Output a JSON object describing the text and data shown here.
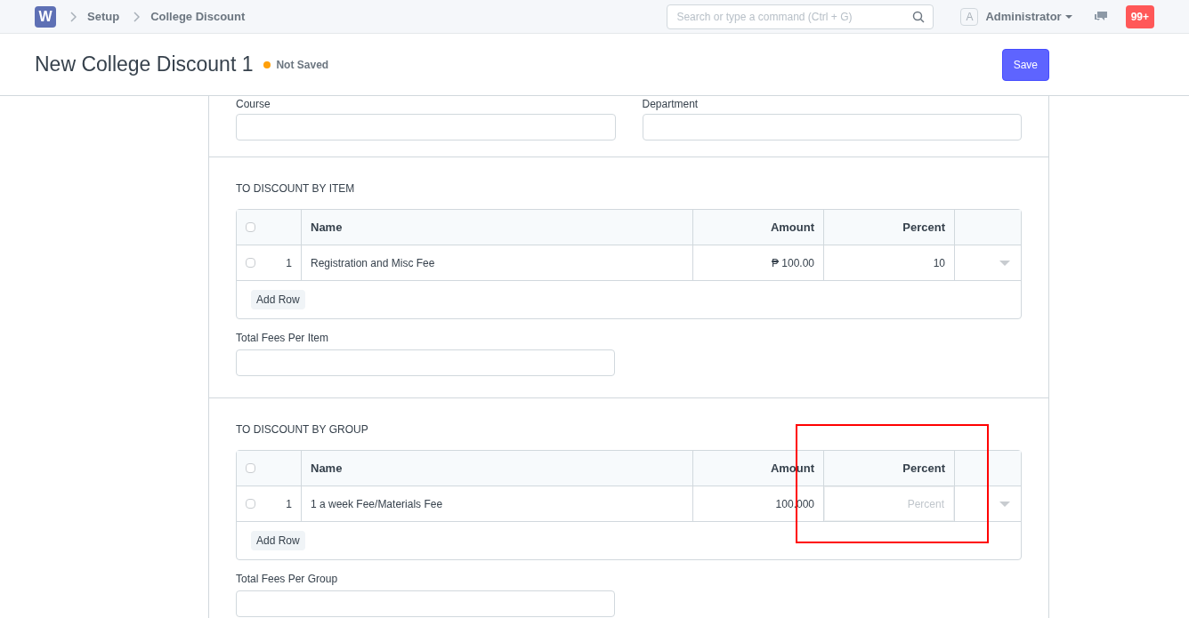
{
  "navbar": {
    "logo": "W",
    "breadcrumbs": [
      "Setup",
      "College Discount"
    ],
    "search": {
      "placeholder": "Search or type a command (Ctrl + G)"
    },
    "avatar": "A",
    "user": "Administrator",
    "notifications": "99+"
  },
  "page": {
    "title": "New College Discount 1",
    "status": "Not Saved",
    "save": "Save"
  },
  "fields_top": [
    {
      "label": "Course"
    },
    {
      "label": "Department"
    }
  ],
  "sections": [
    {
      "title": "TO DISCOUNT BY ITEM",
      "columns": [
        "Name",
        "Amount",
        "Percent"
      ],
      "rows": [
        {
          "index": "1",
          "name": "Registration and Misc Fee",
          "amount": "₱ 100.00",
          "percent": "10",
          "editing": false,
          "checked": false
        }
      ],
      "add_row": "Add Row",
      "total_label": "Total Fees Per Item",
      "all_checked": false
    },
    {
      "title": "TO DISCOUNT BY GROUP",
      "columns": [
        "Name",
        "Amount",
        "Percent"
      ],
      "rows": [
        {
          "index": "1",
          "name": "1 a week Fee/Materials Fee",
          "amount": "100.000",
          "percent_placeholder": "Percent",
          "editing": true,
          "checked": false
        }
      ],
      "add_row": "Add Row",
      "total_label": "Total Fees Per Group",
      "all_checked": false,
      "highlighted": true
    }
  ]
}
